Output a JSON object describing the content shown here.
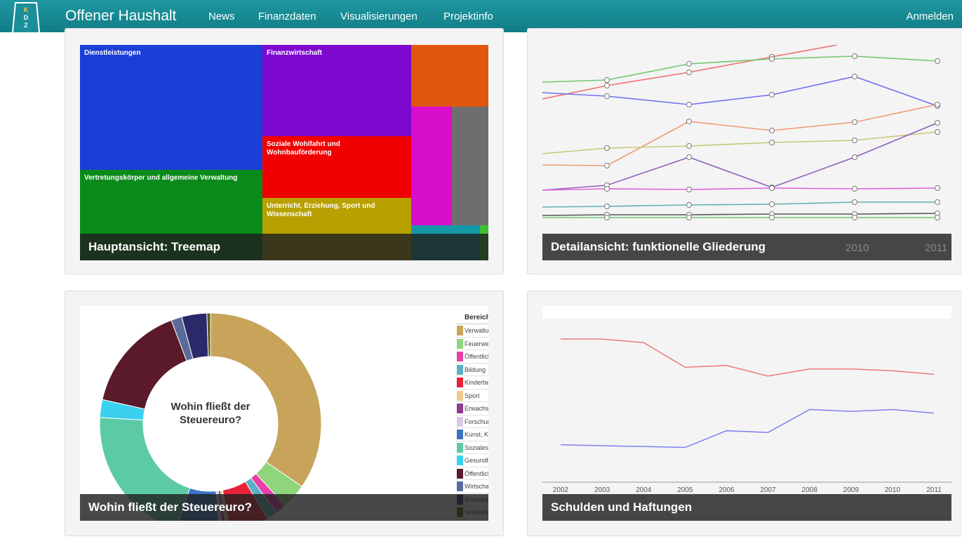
{
  "nav": {
    "brand": "Offener Haushalt",
    "logo_text": "KDZ",
    "links": [
      "News",
      "Finanzdaten",
      "Visualisierungen",
      "Projektinfo"
    ],
    "login": "Anmelden"
  },
  "cards": {
    "treemap": {
      "caption": "Hauptansicht: Treemap",
      "labels": {
        "dienstleistungen": "Dienstleistungen",
        "finanzwirtschaft": "Finanzwirtschaft",
        "soziale": "Soziale Wohlfahrt und Wohnbauförderung",
        "vertretung": "Vertretungskörper und allgemeine Verwaltung",
        "unterricht": "Unterricht, Erziehung, Sport und Wissenschaft"
      }
    },
    "detail": {
      "caption": "Detailansicht: funktionelle Gliederung",
      "x_ticks": [
        "2010",
        "2011"
      ]
    },
    "donut": {
      "caption": "Wohin fließt der Steuereuro?",
      "center_text": "Wohin fließt der Steuereuro?",
      "legend_title": "Bereich",
      "legend": [
        {
          "label": "Verwaltung / Politik",
          "color": "#c8a45a"
        },
        {
          "label": "Feuerwehrwesen",
          "color": "#8fd57c"
        },
        {
          "label": "Öffentliche Ordnung und Sicher...",
          "color": "#e840a8"
        },
        {
          "label": "Bildung",
          "color": "#5ab0c4"
        },
        {
          "label": "Kinderbetreuung / Jugend",
          "color": "#e8223a"
        },
        {
          "label": "Sport",
          "color": "#f5c98a"
        },
        {
          "label": "Erwachsenenbildung",
          "color": "#8e3d8e"
        },
        {
          "label": "Forschung",
          "color": "#d8c8e8"
        },
        {
          "label": "Kunst, Kultur und Kultus",
          "color": "#3a74c4"
        },
        {
          "label": "Soziales",
          "color": "#5ccaa6"
        },
        {
          "label": "Gesundheit",
          "color": "#3ad0f0"
        },
        {
          "label": "Öffentlicher Raum",
          "color": "#5a1a2a"
        },
        {
          "label": "Wirtschaftsförderung",
          "color": "#5a6a9a"
        },
        {
          "label": "Betriebsähnliche Einrichtungen ...",
          "color": "#2a2a6a"
        },
        {
          "label": "Verbleibender Betrag für Invest...",
          "color": "#5a5a1a"
        }
      ]
    },
    "debt": {
      "caption": "Schulden und Haftungen",
      "x_ticks": [
        "2002",
        "2003",
        "2004",
        "2005",
        "2006",
        "2007",
        "2008",
        "2009",
        "2010",
        "2011"
      ]
    }
  },
  "chart_data": [
    {
      "type": "pie",
      "title": "Wohin fließt der Steuereuro?",
      "categories": [
        "Verwaltung / Politik",
        "Feuerwehrwesen",
        "Öffentliche Ordnung und Sicher...",
        "Bildung",
        "Kinderbetreuung / Jugend",
        "Sport",
        "Erwachsenenbildung",
        "Forschung",
        "Kunst, Kultur und Kultus",
        "Soziales",
        "Gesundheit",
        "Öffentlicher Raum",
        "Wirtschaftsförderung",
        "Betriebsähnliche Einrichtungen ...",
        "Verbleibender Betrag für Invest..."
      ],
      "values": [
        33,
        3.5,
        1.5,
        1.5,
        5.5,
        0.5,
        0.5,
        0.5,
        6,
        20,
        2.5,
        15,
        1.5,
        3.5,
        0.5
      ]
    },
    {
      "type": "line",
      "x": [
        "2002",
        "2003",
        "2004",
        "2005",
        "2006",
        "2007",
        "2008",
        "2009",
        "2010",
        "2011"
      ],
      "series": [
        {
          "values": [
            100,
            100,
            98,
            84,
            85,
            79,
            83,
            83,
            82,
            80
          ]
        },
        {
          "values": [
            40,
            39.5,
            39,
            38.5,
            48,
            47,
            60,
            59,
            60,
            58
          ]
        }
      ],
      "ylim": [
        20,
        110
      ]
    }
  ]
}
